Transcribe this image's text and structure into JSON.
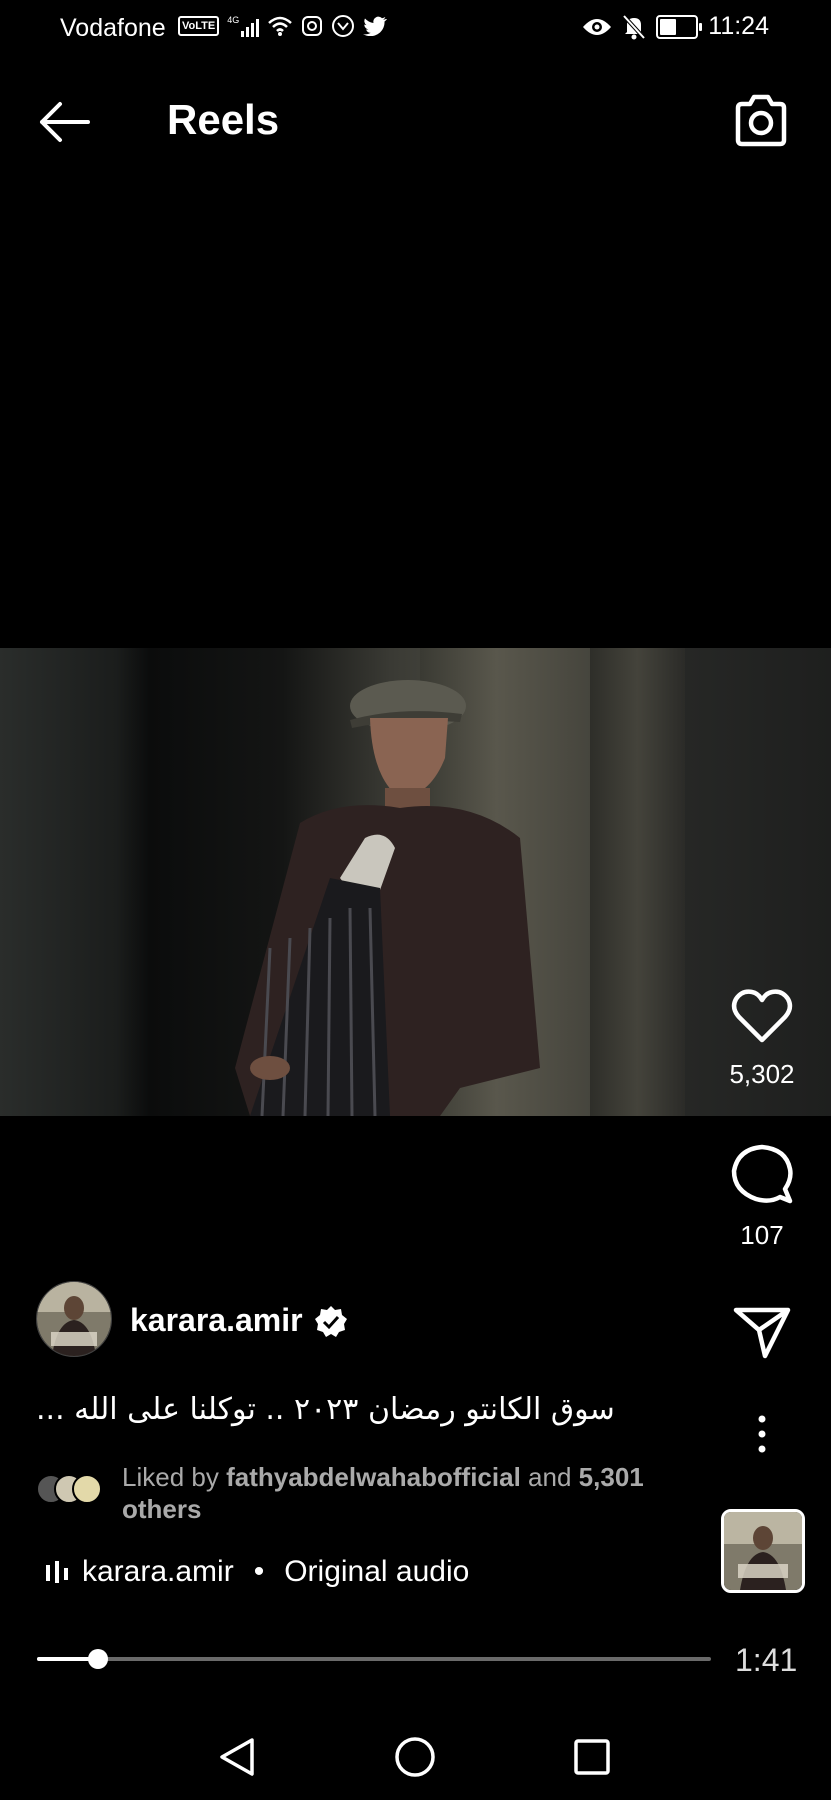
{
  "status_bar": {
    "carrier": "Vodafone",
    "volte": "VoLTE",
    "network": "4G",
    "time": "11:24",
    "battery_level": 0.45,
    "icons": [
      "signal-icon",
      "wifi-icon",
      "instagram-icon",
      "vpn-icon",
      "twitter-icon",
      "eye-icon",
      "mute-icon",
      "battery-icon"
    ]
  },
  "header": {
    "title": "Reels",
    "back_icon": "arrow-left-icon",
    "camera_icon": "camera-icon"
  },
  "actions": {
    "likes": "5,302",
    "comments": "107"
  },
  "post": {
    "username": "karara.amir",
    "caption": "سوق الكانتو رمضان ٢٠٢٣ .. توكلنا على الله ...",
    "liked_prefix": "Liked by",
    "liked_user": "fathyabdelwahabofficial",
    "liked_and": "and",
    "liked_count": "5,301",
    "liked_suffix": "others",
    "audio_user": "karara.amir",
    "audio_sep": "•",
    "audio_label": "Original audio"
  },
  "playback": {
    "progress": 0.09,
    "duration": "1:41"
  },
  "colors": {
    "background": "#000000",
    "muted_text": "#aaaaaa",
    "track": "#6a6a6a"
  }
}
